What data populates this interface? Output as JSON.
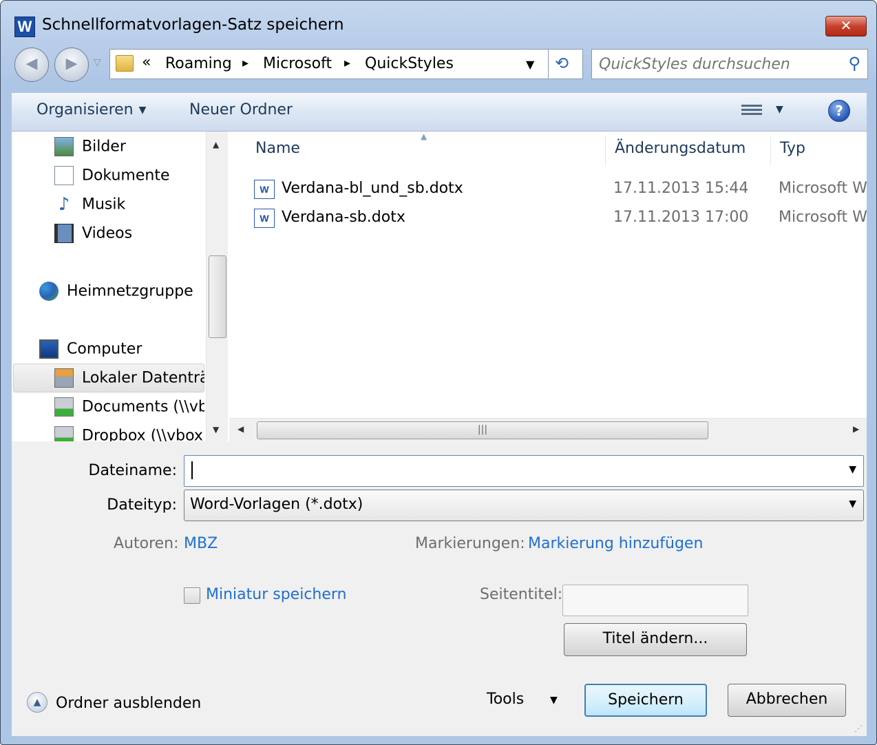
{
  "window": {
    "title": "Schnellformatvorlagen-Satz speichern",
    "close_label": "✕",
    "app_icon_letter": "W"
  },
  "address": {
    "overflow": "«",
    "crumbs": [
      "Roaming",
      "Microsoft",
      "QuickStyles"
    ]
  },
  "search": {
    "placeholder": "QuickStyles durchsuchen"
  },
  "toolbar": {
    "organize_label": "Organisieren",
    "new_folder_label": "Neuer Ordner"
  },
  "nav_pane": {
    "items": [
      {
        "label": "Bilder",
        "icon": "pictures-icon"
      },
      {
        "label": "Dokumente",
        "icon": "documents-icon"
      },
      {
        "label": "Musik",
        "icon": "music-icon"
      },
      {
        "label": "Videos",
        "icon": "videos-icon"
      },
      {
        "label": "Heimnetzgruppe",
        "icon": "homegroup-icon"
      },
      {
        "label": "Computer",
        "icon": "computer-icon"
      },
      {
        "label": "Lokaler Datenträg",
        "icon": "local-disk-icon",
        "selected": true
      },
      {
        "label": "Documents (\\\\vb",
        "icon": "network-drive-icon"
      },
      {
        "label": "Dropbox (\\\\vbox",
        "icon": "network-drive-icon"
      }
    ]
  },
  "file_list": {
    "columns": [
      "Name",
      "Änderungsdatum",
      "Typ"
    ],
    "rows": [
      {
        "name": "Verdana-bl_und_sb.dotx",
        "date": "17.11.2013 15:44",
        "type": "Microsoft Word"
      },
      {
        "name": "Verdana-sb.dotx",
        "date": "17.11.2013 17:00",
        "type": "Microsoft Word"
      }
    ],
    "file_icon_letter": "W"
  },
  "form": {
    "filename_label": "Dateiname:",
    "filename_value": "",
    "filetype_label": "Dateityp:",
    "filetype_value": "Word-Vorlagen (*.dotx)",
    "authors_label": "Autoren:",
    "authors_value": "MBZ",
    "tags_label": "Markierungen:",
    "tags_value": "Markierung hinzufügen",
    "thumbnail_label": "Miniatur speichern",
    "page_title_label": "Seitentitel:",
    "change_title_label": "Titel ändern..."
  },
  "footer": {
    "hide_folders_label": "Ordner ausblenden",
    "tools_label": "Tools",
    "save_label": "Speichern",
    "cancel_label": "Abbrechen"
  },
  "colors": {
    "link": "#1e6fd0",
    "toolbar_text": "#1e395b",
    "frame": "#b9cee9"
  }
}
